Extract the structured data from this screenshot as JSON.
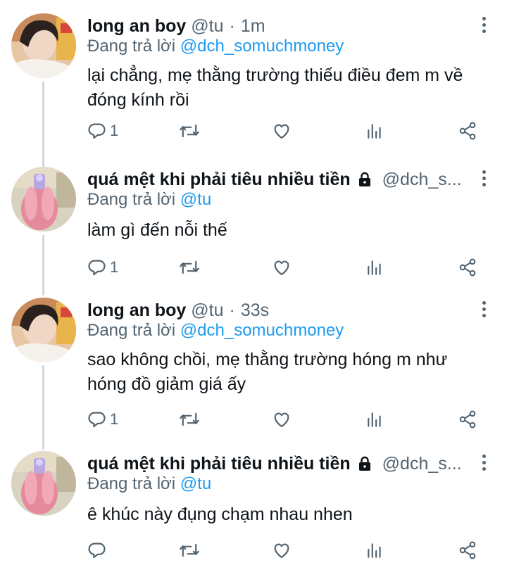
{
  "tweets": [
    {
      "name": "long an boy",
      "handle": "@tu",
      "dot": "·",
      "time": "1m",
      "replying_prefix": "Đang trả lời",
      "replying_to": "@dch_somuchmoney",
      "text": "lại chẳng, mẹ thằng trường thiếu điều đem m về đóng kính rồi",
      "reply_count": "1",
      "locked": false
    },
    {
      "name": "quá mệt khi phải tiêu nhiều tiền",
      "handle": "@dch_s...",
      "time": "",
      "replying_prefix": "Đang trả lời",
      "replying_to": "@tu",
      "text": "làm gì đến nỗi thế",
      "reply_count": "1",
      "locked": true
    },
    {
      "name": "long an boy",
      "handle": "@tu",
      "dot": "·",
      "time": "33s",
      "replying_prefix": "Đang trả lời",
      "replying_to": "@dch_somuchmoney",
      "text": "sao không chồi, mẹ thằng trường hóng m như hóng đồ giảm giá ấy",
      "reply_count": "1",
      "locked": false
    },
    {
      "name": "quá mệt khi phải tiêu nhiều tiền",
      "handle": "@dch_s...",
      "time": "",
      "replying_prefix": "Đang trả lời",
      "replying_to": "@tu",
      "text": "ê khúc này đụng chạm nhau nhen",
      "reply_count": "",
      "locked": true
    }
  ],
  "icons": {
    "reply": "reply-icon",
    "retweet": "retweet-icon",
    "like": "like-icon",
    "views": "views-icon",
    "share": "share-icon",
    "more": "more-options-icon",
    "lock": "lock-icon"
  },
  "colors": {
    "text": "#0f1419",
    "secondary": "#536471",
    "link": "#1d9bf0",
    "thread_line": "#cfd9de"
  }
}
